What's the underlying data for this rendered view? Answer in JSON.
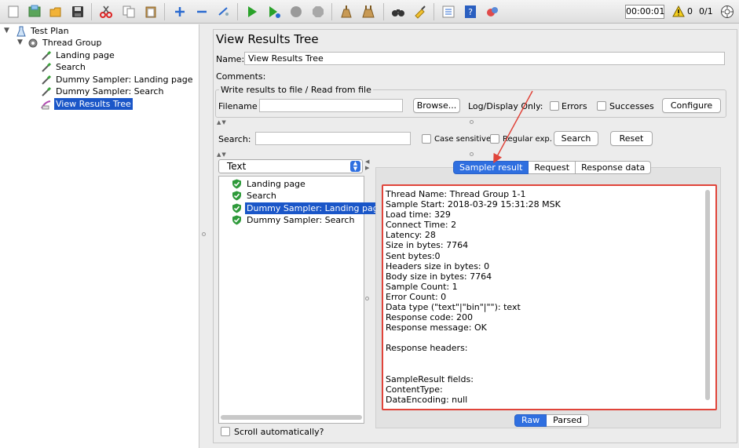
{
  "toolbar": {
    "icons": [
      "new-icon",
      "templates-icon",
      "open-icon",
      "save-icon",
      "cut-icon",
      "copy-icon",
      "paste-icon",
      "expand-icon",
      "collapse-icon",
      "toggle-icon",
      "start-icon",
      "start-no-pause-icon",
      "stop-icon",
      "shutdown-icon",
      "clear-icon",
      "clear-all-icon",
      "search-icon",
      "reset-search-icon",
      "function-helper-icon",
      "help-icon",
      "remote-icon"
    ],
    "timer": "00:00:01",
    "warn_count": "0",
    "threads": "0/1"
  },
  "tree": {
    "test_plan": "Test Plan",
    "thread_group": "Thread Group",
    "landing_page": "Landing page",
    "search": "Search",
    "dummy_landing": "Dummy Sampler: Landing page",
    "dummy_search": "Dummy Sampler: Search",
    "view_results_tree": "View Results Tree"
  },
  "panel": {
    "title": "View Results Tree",
    "name_label": "Name:",
    "name_value": "View Results Tree",
    "comments_label": "Comments:",
    "write_results_title": "Write results to file / Read from file",
    "filename_label": "Filename",
    "browse_label": "Browse...",
    "log_display_label": "Log/Display Only:",
    "errors_label": "Errors",
    "successes_label": "Successes",
    "configure_label": "Configure",
    "search_label": "Search:",
    "case_sensitive_label": "Case sensitive",
    "regular_exp_label": "Regular exp.",
    "search_button": "Search",
    "reset_button": "Reset",
    "renderer_selected": "Text",
    "scroll_auto_label": "Scroll automatically?"
  },
  "results_list": [
    {
      "label": "Landing page",
      "selected": false
    },
    {
      "label": "Search",
      "selected": false
    },
    {
      "label": "Dummy Sampler: Landing page",
      "selected": true
    },
    {
      "label": "Dummy Sampler: Search",
      "selected": false
    }
  ],
  "tabs": [
    "Sampler result",
    "Request",
    "Response data"
  ],
  "active_tab": "Sampler result",
  "view_modes": [
    "Raw",
    "Parsed"
  ],
  "active_view_mode": "Raw",
  "sampler_result_lines": [
    "Thread Name: Thread Group 1-1",
    "Sample Start: 2018-03-29 15:31:28 MSK",
    "Load time: 329",
    "Connect Time: 2",
    "Latency: 28",
    "Size in bytes: 7764",
    "Sent bytes:0",
    "Headers size in bytes: 0",
    "Body size in bytes: 7764",
    "Sample Count: 1",
    "Error Count: 0",
    "Data type (\"text\"|\"bin\"|\"\"): text",
    "Response code: 200",
    "Response message: OK",
    "",
    "Response headers:",
    "",
    "",
    "SampleResult fields:",
    "ContentType:",
    "DataEncoding: null"
  ],
  "colors": {
    "accent": "#2f6fe0",
    "selection": "#1a56c8",
    "highlight_border": "#e0443a",
    "success": "#2e9a3a"
  }
}
